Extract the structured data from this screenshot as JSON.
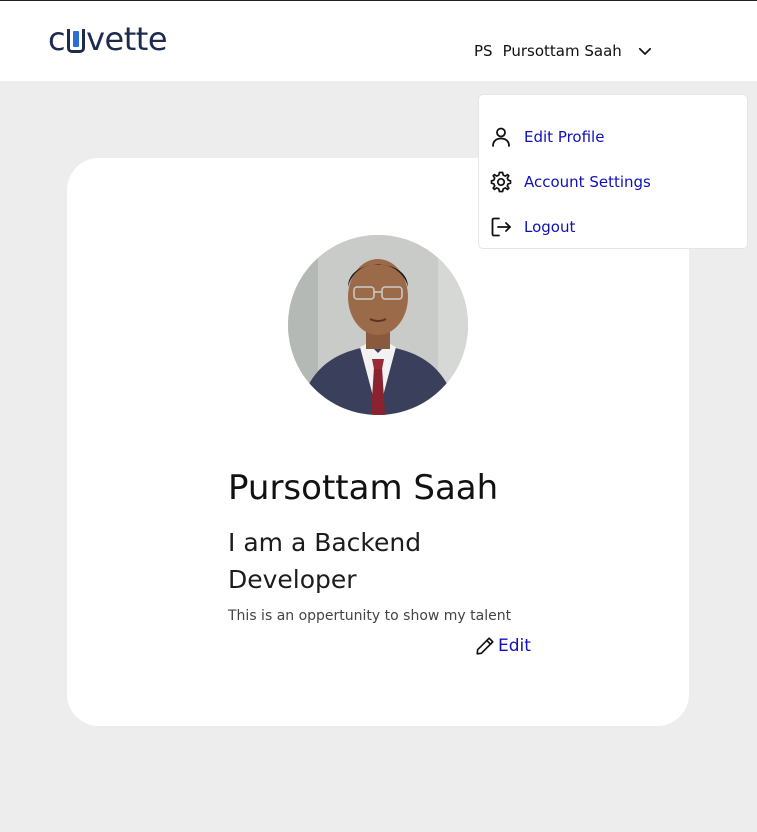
{
  "brand": {
    "logo_text_before": "c",
    "logo_text_after": "vette"
  },
  "header": {
    "user_initials": "PS",
    "user_name": "Pursottam Saah"
  },
  "dropdown": {
    "items": [
      {
        "label": "Edit Profile",
        "icon": "user-icon"
      },
      {
        "label": "Account Settings",
        "icon": "gear-icon"
      },
      {
        "label": "Logout",
        "icon": "logout-icon"
      }
    ]
  },
  "profile": {
    "name": "Pursottam Saah",
    "headline": "I am a Backend Developer",
    "bio": "This is an oppertunity to show my talent",
    "edit_label": "Edit"
  },
  "colors": {
    "background": "#ededed",
    "link": "#1010b8",
    "brand_dark": "#1d2b4f",
    "brand_accent": "#2b6fd6"
  }
}
